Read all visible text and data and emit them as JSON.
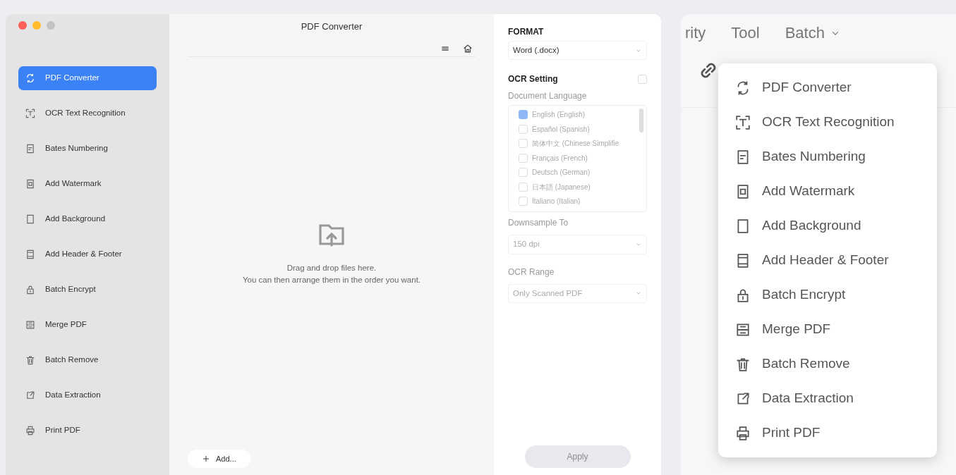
{
  "window": {
    "title": "PDF Converter"
  },
  "sidebar": {
    "items": [
      {
        "label": "PDF Converter",
        "selected": true
      },
      {
        "label": "OCR Text Recognition",
        "selected": false
      },
      {
        "label": "Bates Numbering",
        "selected": false
      },
      {
        "label": "Add Watermark",
        "selected": false
      },
      {
        "label": "Add Background",
        "selected": false
      },
      {
        "label": "Add Header & Footer",
        "selected": false
      },
      {
        "label": "Batch Encrypt",
        "selected": false
      },
      {
        "label": "Merge PDF",
        "selected": false
      },
      {
        "label": "Batch Remove",
        "selected": false
      },
      {
        "label": "Data Extraction",
        "selected": false
      },
      {
        "label": "Print PDF",
        "selected": false
      }
    ]
  },
  "drop_zone": {
    "lines": [
      "Drag and drop files here.",
      "You can then arrange them in the order you want."
    ]
  },
  "add_button": {
    "label": "Add..."
  },
  "settings": {
    "format_label": "FORMAT",
    "format": "Word (.docx)",
    "ocr_label": "OCR Setting",
    "ocr_checked": false,
    "language_label": "Document Language",
    "languages": [
      {
        "label": "English (English)",
        "checked": true
      },
      {
        "label": "Español (Spanish)",
        "checked": false
      },
      {
        "label": "简体中文 (Chinese Simplifie",
        "checked": false
      },
      {
        "label": "Français (French)",
        "checked": false
      },
      {
        "label": "Deutsch (German)",
        "checked": false
      },
      {
        "label": "日本語 (Japanese)",
        "checked": false
      },
      {
        "label": "Italiano (Italian)",
        "checked": false
      }
    ],
    "downsample_label": "Downsample To",
    "downsample": "150 dpi",
    "range_label": "OCR Range",
    "range": "Only Scanned PDF",
    "apply": {
      "label": "Apply",
      "disabled": true
    }
  },
  "background_app": {
    "menu": [
      {
        "label": "rity",
        "has_caret": false
      },
      {
        "label": "Tool",
        "has_caret": false
      },
      {
        "label": "Batch",
        "has_caret": true
      }
    ]
  },
  "batch_menu": {
    "items": [
      "PDF Converter",
      "OCR Text Recognition",
      "Bates Numbering",
      "Add Watermark",
      "Add Background",
      "Add Header & Footer",
      "Batch Encrypt",
      "Merge PDF",
      "Batch Remove",
      "Data Extraction",
      "Print PDF"
    ]
  }
}
